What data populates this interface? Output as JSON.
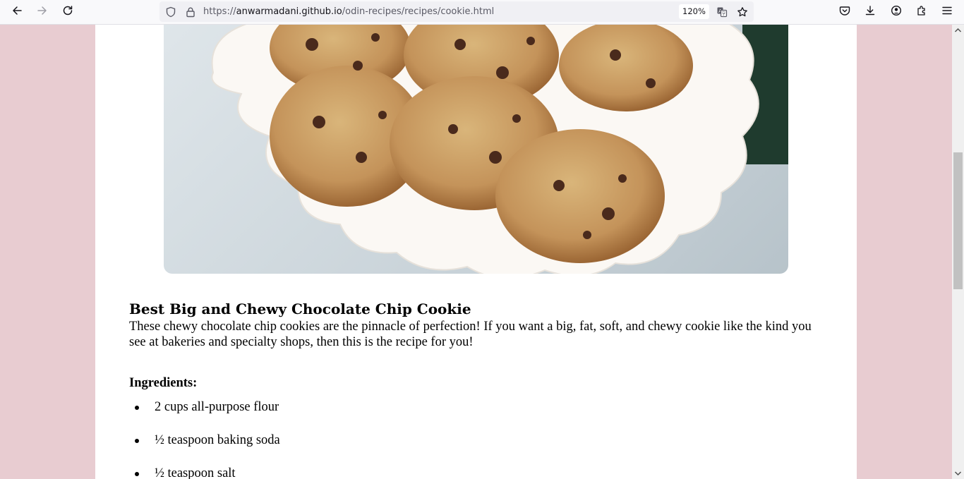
{
  "browser": {
    "url_scheme": "https://",
    "url_host": "anwarmadani.github.io",
    "url_path": "/odin-recipes/recipes/cookie.html",
    "zoom": "120%",
    "icons": [
      "back-arrow-icon",
      "forward-arrow-icon",
      "reload-icon",
      "shield-icon",
      "lock-icon",
      "translate-icon",
      "bookmark-star-icon",
      "pocket-icon",
      "download-icon",
      "account-icon",
      "extensions-icon",
      "menu-icon"
    ]
  },
  "recipe": {
    "image_alt": "Plate of chocolate chip cookies",
    "title": "Best Big and Chewy Chocolate Chip Cookie",
    "description": "These chewy chocolate chip cookies are the pinnacle of perfection! If you want a big, fat, soft, and chewy cookie like the kind you see at bakeries and specialty shops, then this is the recipe for you!",
    "ingredients_heading": "Ingredients:",
    "ingredients": [
      "2 cups all-purpose flour",
      "½ teaspoon baking soda",
      "½ teaspoon salt"
    ]
  },
  "colors": {
    "page_background": "#e8ccd1",
    "content_background": "#ffffff",
    "toolbar_background": "#f9f9fb"
  }
}
